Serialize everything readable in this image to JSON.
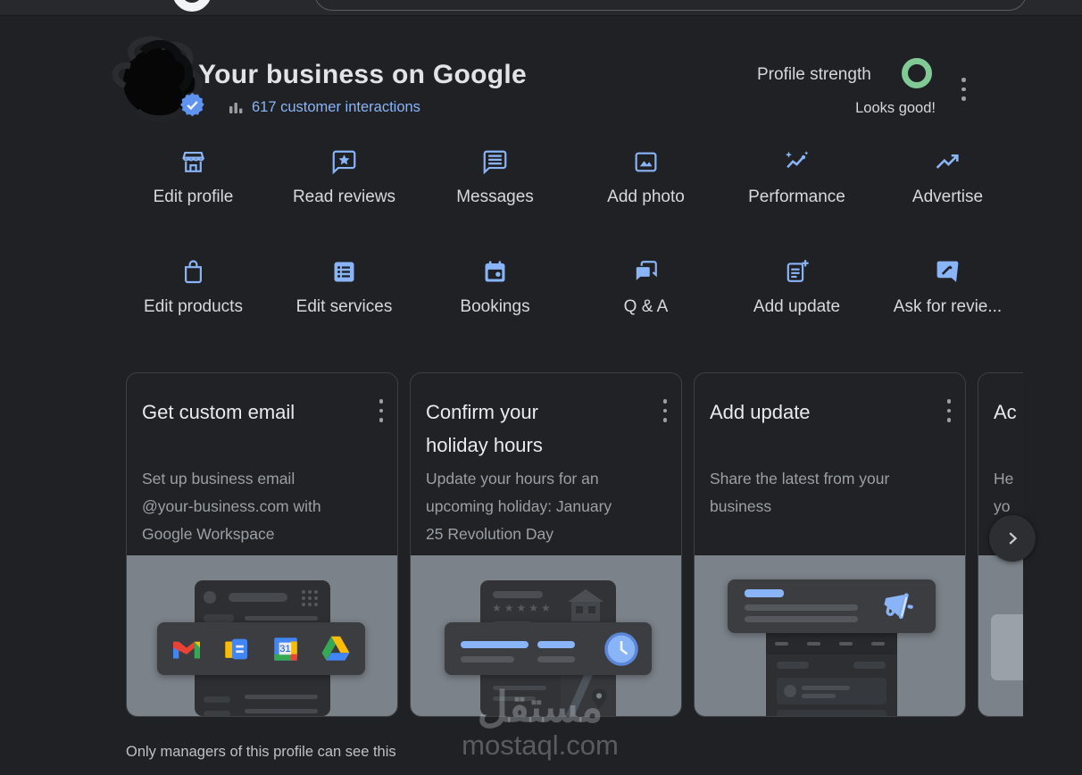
{
  "header": {
    "title": "Your business on Google",
    "interactions_link": "617 customer interactions",
    "profile_strength_label": "Profile strength",
    "profile_strength_status": "Looks good!"
  },
  "actions": {
    "row1": [
      {
        "label": "Edit profile",
        "icon": "storefront-icon"
      },
      {
        "label": "Read reviews",
        "icon": "review-star-bubble-icon"
      },
      {
        "label": "Messages",
        "icon": "message-bubble-icon"
      },
      {
        "label": "Add photo",
        "icon": "photo-icon"
      },
      {
        "label": "Performance",
        "icon": "performance-sparkline-icon"
      },
      {
        "label": "Advertise",
        "icon": "trending-up-icon"
      }
    ],
    "row2": [
      {
        "label": "Edit products",
        "icon": "shopping-bag-icon"
      },
      {
        "label": "Edit services",
        "icon": "list-box-icon"
      },
      {
        "label": "Bookings",
        "icon": "calendar-icon"
      },
      {
        "label": "Q & A",
        "icon": "forum-icon"
      },
      {
        "label": "Add update",
        "icon": "post-add-icon"
      },
      {
        "label": "Ask for revie...",
        "icon": "rate-review-icon"
      }
    ]
  },
  "cards": [
    {
      "title": "Get custom email",
      "description": "Set up business email @your-business.com with Google Workspace"
    },
    {
      "title": "Confirm your holiday hours",
      "description": "Update your hours for an upcoming holiday: January 25 Revolution Day"
    },
    {
      "title": "Add update",
      "description": "Share the latest from your business"
    },
    {
      "title": "Ac",
      "description_lines": [
        "He",
        "yo"
      ]
    }
  ],
  "illustrations": {
    "calendar_day": "31"
  },
  "footer": {
    "note": "Only managers of this profile can see this"
  },
  "watermark": {
    "line1": "مستقل",
    "line2": "mostaql.com"
  },
  "colors": {
    "accent_blue": "#8ab4f8",
    "strength_green": "#81c995",
    "illustration_bg": "#7b8289",
    "google_blue": "#4285f4",
    "google_red": "#ea4335",
    "google_yellow": "#fbbc04",
    "google_green": "#34a853"
  }
}
